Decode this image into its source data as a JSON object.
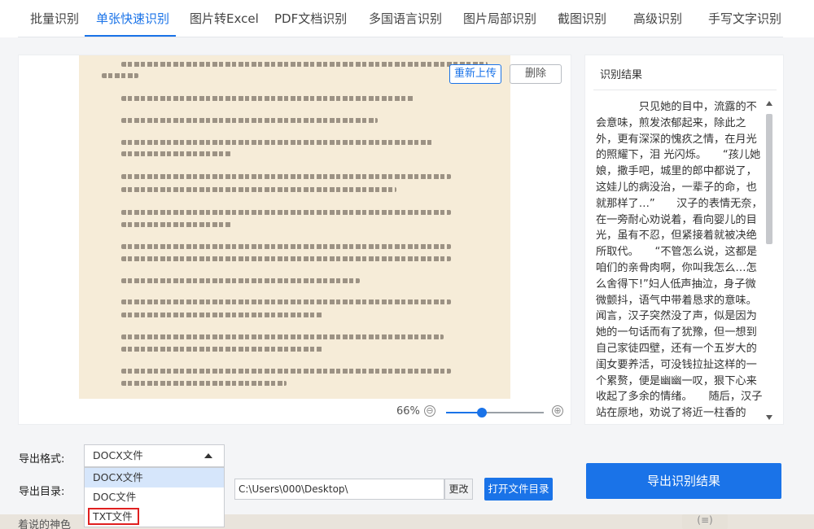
{
  "tabs": [
    {
      "label": "批量识别"
    },
    {
      "label": "单张快速识别"
    },
    {
      "label": "图片转Excel"
    },
    {
      "label": "PDF文档识别"
    },
    {
      "label": "多国语言识别"
    },
    {
      "label": "图片局部识别"
    },
    {
      "label": "截图识别"
    },
    {
      "label": "高级识别"
    },
    {
      "label": "手写文字识别"
    }
  ],
  "active_tab": "单张快速识别",
  "preview": {
    "reupload_label": "重新上传",
    "delete_label": "删除",
    "zoom": {
      "label": "66%",
      "level": 0.37,
      "minus": "⊖",
      "plus": "⊕"
    }
  },
  "result": {
    "title": "识别结果",
    "text": "只见她的目中，流露的不会意味，煎发浓郁起来，除此之外，更有深深的愧疚之情，在月光的照耀下，泪 光闪烁。　　“孩儿她娘，撒手吧，城里的郎中都说了，这娃儿的病没治，一辈子的命，也就那样了…”　　汉子的表情无奈，在一旁耐心劝说着，看向婴儿的目光，虽有不忍，但紧接着就被决绝所取代。　　“不管怎么说，这都是咱们的亲骨肉啊，你叫我怎么…怎么舍得下!”妇人低声抽泣，身子微微颤抖，语气中带着恳求的意味。　　闻言，汉子突然没了声，似是因为她的一句话而有了犹豫，但一想到自己家徒四壁，还有一个五岁大的闺女要养活，可没钱拉扯这样的一个累赘，便是幽幽一叹，狠下心来收起了多余的情绪。　　随后，汉子站在原地，劝说了将近一柱香的"
  },
  "export": {
    "format_label": "导出格式:",
    "format_selected": "DOCX文件",
    "format_options": [
      "DOCX文件",
      "DOC文件",
      "TXT文件"
    ],
    "dir_label": "导出目录:",
    "dir_value": "C:\\Users\\000\\Desktop\\",
    "change_label": "更改",
    "open_dir_label": "打开文件目录",
    "export_label": "导出识别结果"
  },
  "bottom": {
    "text": "着说的神色",
    "icon_glyph": "(≡)"
  }
}
